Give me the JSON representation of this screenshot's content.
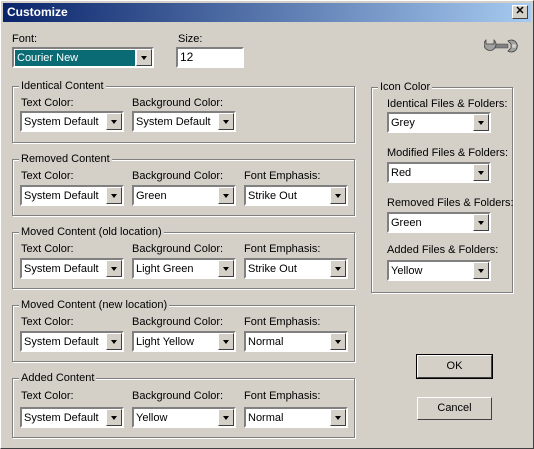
{
  "window": {
    "title": "Customize",
    "close_glyph": "✕"
  },
  "font": {
    "label": "Font:",
    "value": "Courier New"
  },
  "size": {
    "label": "Size:",
    "value": "12"
  },
  "column_labels": {
    "text_color": "Text Color:",
    "background_color": "Background Color:",
    "font_emphasis": "Font Emphasis:"
  },
  "groups": {
    "identical": {
      "title": "Identical Content",
      "text_color": "System Default",
      "background_color": "System Default"
    },
    "removed": {
      "title": "Removed Content",
      "text_color": "System Default",
      "background_color": "Green",
      "font_emphasis": "Strike Out"
    },
    "moved_old": {
      "title": "Moved Content (old location)",
      "text_color": "System Default",
      "background_color": "Light Green",
      "font_emphasis": "Strike Out"
    },
    "moved_new": {
      "title": "Moved Content (new location)",
      "text_color": "System Default",
      "background_color": "Light Yellow",
      "font_emphasis": "Normal"
    },
    "added": {
      "title": "Added Content",
      "text_color": "System Default",
      "background_color": "Yellow",
      "font_emphasis": "Normal"
    }
  },
  "icon_color": {
    "title": "Icon Color",
    "identical": {
      "label": "Identical Files & Folders:",
      "value": "Grey"
    },
    "modified": {
      "label": "Modified Files & Folders:",
      "value": "Red"
    },
    "removed": {
      "label": "Removed Files & Folders:",
      "value": "Green"
    },
    "added": {
      "label": "Added Files & Folders:",
      "value": "Yellow"
    }
  },
  "buttons": {
    "ok": "OK",
    "cancel": "Cancel"
  },
  "icons": {
    "settings": "wrench-icon"
  }
}
